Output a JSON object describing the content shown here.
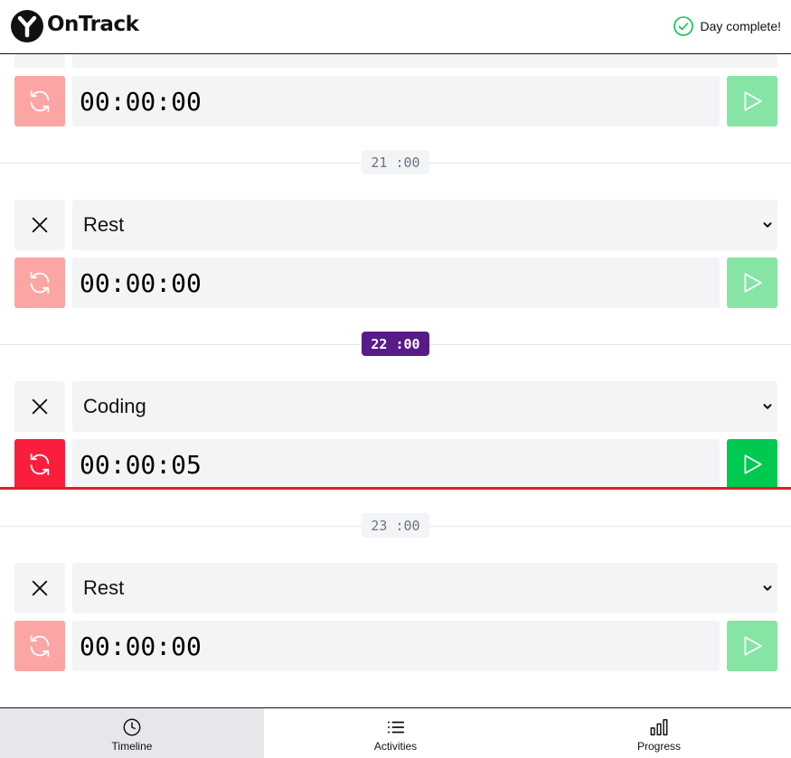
{
  "app": {
    "brand": "OnTrack",
    "day_status": "Day complete!"
  },
  "timeline": {
    "hours": [
      {
        "label": "21 :00",
        "current": false
      },
      {
        "label": "22 :00",
        "current": true
      },
      {
        "label": "23 :00",
        "current": false
      }
    ],
    "slots": [
      {
        "activity": "",
        "timer": "00:00:00",
        "active": false
      },
      {
        "activity": "Rest",
        "timer": "00:00:00",
        "active": false
      },
      {
        "activity": "Coding",
        "timer": "00:00:05",
        "active": true
      },
      {
        "activity": "Rest",
        "timer": "00:00:00",
        "active": false
      }
    ]
  },
  "nav": {
    "items": [
      {
        "label": "Timeline",
        "icon": "clock-icon",
        "selected": true
      },
      {
        "label": "Activities",
        "icon": "list-icon",
        "selected": false
      },
      {
        "label": "Progress",
        "icon": "bar-chart-icon",
        "selected": false
      }
    ]
  },
  "colors": {
    "current_hour": "#581c87",
    "now_indicator": "#dc1f26",
    "reset_active": "#f91f3c",
    "reset_inactive": "#fca5a5",
    "play_active": "#00c950",
    "play_inactive": "#86e5a5",
    "status_ok": "#00c950"
  }
}
